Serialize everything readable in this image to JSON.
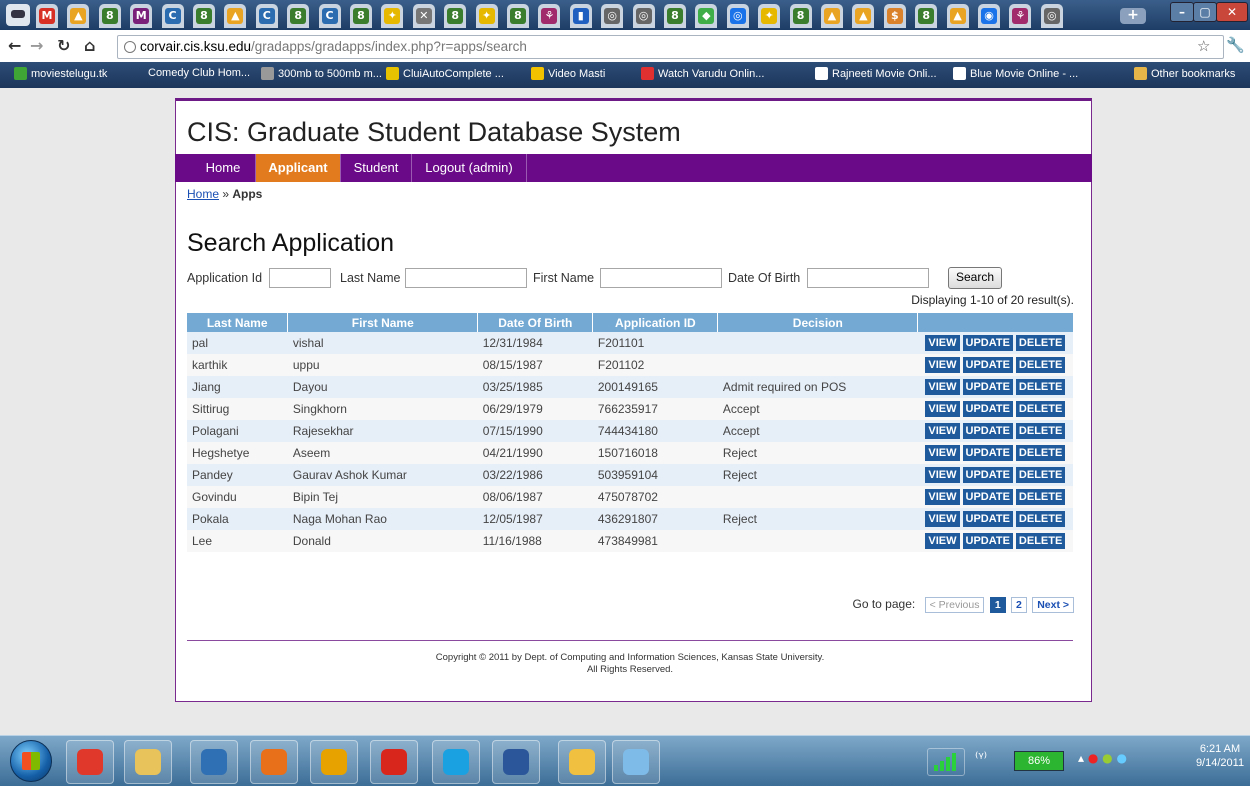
{
  "browser": {
    "tabs": [
      {
        "glyph": "M",
        "color": "#d93025"
      },
      {
        "glyph": "▲",
        "color": "#e9a423"
      },
      {
        "glyph": "8",
        "color": "#3a7d2c"
      },
      {
        "glyph": "M",
        "color": "#7a1f7a"
      },
      {
        "glyph": "C",
        "color": "#2b6cb0"
      },
      {
        "glyph": "8",
        "color": "#3a7d2c"
      },
      {
        "glyph": "▲",
        "color": "#e9a423"
      },
      {
        "glyph": "C",
        "color": "#2b6cb0"
      },
      {
        "glyph": "8",
        "color": "#3a7d2c"
      },
      {
        "glyph": "C",
        "color": "#2b6cb0"
      },
      {
        "glyph": "8",
        "color": "#3a7d2c"
      },
      {
        "glyph": "✦",
        "color": "#e6b800"
      },
      {
        "glyph": "✕",
        "color": "#777777"
      },
      {
        "glyph": "8",
        "color": "#3a7d2c"
      },
      {
        "glyph": "✦",
        "color": "#e6b800"
      },
      {
        "glyph": "8",
        "color": "#3a7d2c"
      },
      {
        "glyph": "⚘",
        "color": "#a02a6b"
      },
      {
        "glyph": "▮",
        "color": "#1f5fbf"
      },
      {
        "glyph": "◎",
        "color": "#666666"
      },
      {
        "glyph": "◎",
        "color": "#666666"
      },
      {
        "glyph": "8",
        "color": "#3a7d2c"
      },
      {
        "glyph": "◆",
        "color": "#3fae49"
      },
      {
        "glyph": "◎",
        "color": "#1a73e8"
      },
      {
        "glyph": "✦",
        "color": "#e6b800"
      },
      {
        "glyph": "8",
        "color": "#3a7d2c"
      },
      {
        "glyph": "▲",
        "color": "#e9a423"
      },
      {
        "glyph": "▲",
        "color": "#e9a423"
      },
      {
        "glyph": "$",
        "color": "#d9822b"
      },
      {
        "glyph": "8",
        "color": "#3a7d2c"
      },
      {
        "glyph": "▲",
        "color": "#e9a423"
      },
      {
        "glyph": "◉",
        "color": "#1a73e8"
      },
      {
        "glyph": "⚘",
        "color": "#a02a6b"
      },
      {
        "glyph": "◎",
        "color": "#666666"
      }
    ],
    "url_host": "corvair.cis.ksu.edu",
    "url_path": "/gradapps/gradapps/index.php?r=apps/search",
    "bookmarks": [
      {
        "label": "moviestelugu.tk",
        "color": "#3fa535"
      },
      {
        "label": "Comedy Club Hom...",
        "color": ""
      },
      {
        "label": "300mb to 500mb m...",
        "color": "#999999"
      },
      {
        "label": "CluiAutoComplete ...",
        "color": "#e6c200"
      },
      {
        "label": "Video Masti",
        "color": "#f2c200"
      },
      {
        "label": "Watch Varudu Onlin...",
        "color": "#e03030"
      },
      {
        "label": "Rajneeti Movie Onli...",
        "color": "#ffffff"
      },
      {
        "label": "Blue Movie Online - ...",
        "color": "#ffffff"
      }
    ],
    "other_bookmarks": "Other bookmarks"
  },
  "site": {
    "title": "CIS: Graduate Student Database System",
    "nav": [
      "Home",
      "Applicant",
      "Student",
      "Logout (admin)"
    ],
    "breadcrumb_home": "Home",
    "breadcrumb_sep": " » ",
    "breadcrumb_current": "Apps",
    "heading": "Search Application"
  },
  "search": {
    "labels": [
      "Application Id",
      "Last Name",
      "First Name",
      "Date Of Birth"
    ],
    "button": "Search",
    "result_count": "Displaying 1-10 of 20 result(s)."
  },
  "table": {
    "columns": [
      "Last Name",
      "First Name",
      "Date Of Birth",
      "Application ID",
      "Decision",
      ""
    ],
    "rows": [
      [
        "pal",
        "vishal",
        "12/31/1984",
        "F201101",
        ""
      ],
      [
        "karthik",
        "uppu",
        "08/15/1987",
        "F201102",
        ""
      ],
      [
        "Jiang",
        "Dayou",
        "03/25/1985",
        "200149165",
        "Admit required on POS"
      ],
      [
        "Sittirug",
        "Singkhorn",
        "06/29/1979",
        "766235917",
        "Accept"
      ],
      [
        "Polagani",
        "Rajesekhar",
        "07/15/1990",
        "744434180",
        "Accept"
      ],
      [
        "Hegshetye",
        "Aseem",
        "04/21/1990",
        "150716018",
        "Reject"
      ],
      [
        "Pandey",
        "Gaurav Ashok Kumar",
        "03/22/1986",
        "503959104",
        "Reject"
      ],
      [
        "Govindu",
        "Bipin Tej",
        "08/06/1987",
        "475078702",
        ""
      ],
      [
        "Pokala",
        "Naga Mohan Rao",
        "12/05/1987",
        "436291807",
        "Reject"
      ],
      [
        "Lee",
        "Donald",
        "11/16/1988",
        "473849981",
        ""
      ]
    ],
    "actions": [
      "VIEW",
      "UPDATE",
      "DELETE"
    ]
  },
  "pager": {
    "label": "Go to page:",
    "previous": "< Previous",
    "pages": [
      "1",
      "2"
    ],
    "current": "1",
    "next": "Next >"
  },
  "footer": {
    "line1": "Copyright © 2011 by Dept. of Computing and Information Sciences, Kansas State University.",
    "line2": "All Rights Reserved."
  },
  "taskbar": {
    "apps": [
      {
        "name": "chrome-app",
        "color": "#e0392b"
      },
      {
        "name": "explorer-app",
        "color": "#e8c25a"
      },
      {
        "name": "virtualbox-app",
        "color": "#2f6fb3"
      },
      {
        "name": "firefox-app",
        "color": "#e8701a"
      },
      {
        "name": "outlook-app",
        "color": "#e8a200"
      },
      {
        "name": "avast-app",
        "color": "#d8261c"
      },
      {
        "name": "skype-app",
        "color": "#1aa1e1"
      },
      {
        "name": "word-app",
        "color": "#2b579a"
      },
      {
        "name": "notepad-app",
        "color": "#f0c040"
      },
      {
        "name": "paint-app",
        "color": "#7fbbe8"
      }
    ],
    "battery": "86%",
    "time": "6:21 AM",
    "date": "9/14/2011"
  }
}
